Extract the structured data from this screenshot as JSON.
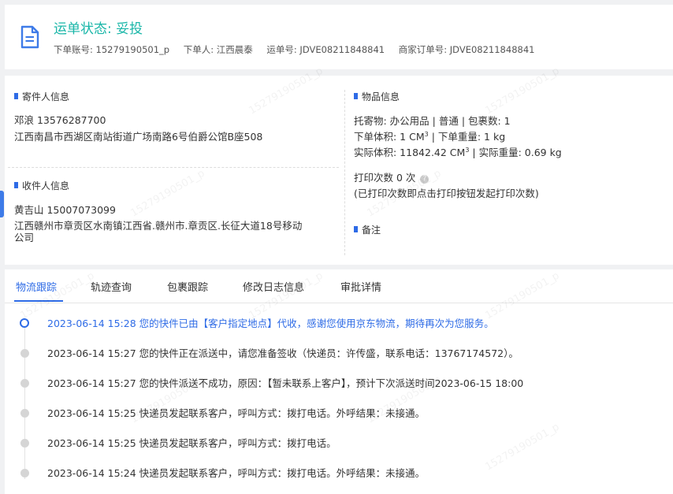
{
  "header": {
    "status_label": "运单状态: 妥投",
    "meta": [
      "下单账号: 15279190501_p",
      "下单人: 江西晨泰",
      "运单号: JDVE08211848841",
      "商家订单号: JDVE08211848841"
    ]
  },
  "sender": {
    "title": "寄件人信息",
    "name_phone": "邓浪   13576287700",
    "address": "江西南昌市西湖区南站街道广场南路6号伯爵公馆B座508"
  },
  "receiver": {
    "title": "收件人信息",
    "name_phone": "黄吉山   15007073099",
    "address_line1": "江西赣州市章贡区水南镇江西省.赣州市.章贡区.长征大道18号移动",
    "address_line2": "公司"
  },
  "goods": {
    "title": "物品信息",
    "line1": "托寄物:  办公用品 | 普通  |  包裹数:  1",
    "line2_pre": "下单体积:   1 CM",
    "line2_post": " |  下单重量:   1 kg",
    "line3_pre": "实际体积:   11842.42 CM",
    "line3_post": " |  实际重量:   0.69 kg",
    "superscript": "3",
    "print_count": "打印次数    0 次",
    "print_hint": "(已打印次数即点击打印按钮发起打印次数)"
  },
  "remark": {
    "title": "备注"
  },
  "tabs": [
    "物流跟踪",
    "轨迹查询",
    "包裹跟踪",
    "修改日志信息",
    "审批详情"
  ],
  "timeline": [
    "2023-06-14 15:28  您的快件已由【客户指定地点】代收，感谢您使用京东物流，期待再次为您服务。",
    "2023-06-14 15:27  您的快件正在派送中，请您准备签收（快递员：许传盛，联系电话：13767174572）。",
    "2023-06-14 15:27  您的快件派送不成功，原因：【暂未联系上客户】，预计下次派送时间2023-06-15 18:00",
    "2023-06-14 15:25  快递员发起联系客户，呼叫方式：拨打电话。外呼结果：未接通。",
    "2023-06-14 15:25  快递员发起联系客户，呼叫方式：拨打电话。",
    "2023-06-14 15:24  快递员发起联系客户，呼叫方式：拨打电话。外呼结果：未接通。"
  ],
  "colors": {
    "accent": "#2e6be6",
    "status": "#19b6a8"
  },
  "watermark": "15279190501_p"
}
